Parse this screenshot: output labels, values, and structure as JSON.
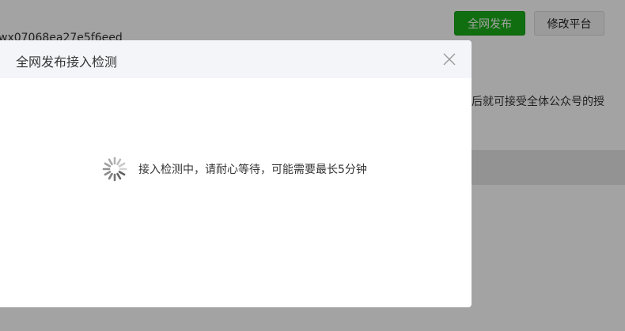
{
  "background": {
    "app_id": "wx07068ea27e5f6eed",
    "description": "后就可接受全体公众号的授",
    "buttons": {
      "publish_label": "全网发布",
      "modify_label": "修改平台"
    }
  },
  "dialog": {
    "title": "全网发布接入检测",
    "loading_text": "接入检测中，请耐心等待，可能需要最长5分钟"
  },
  "colors": {
    "primary_green": "#1aad19",
    "overlay": "rgba(0,0,0,0.36)"
  },
  "icons": {
    "close": "close-icon",
    "loading": "loading-spinner-icon"
  }
}
